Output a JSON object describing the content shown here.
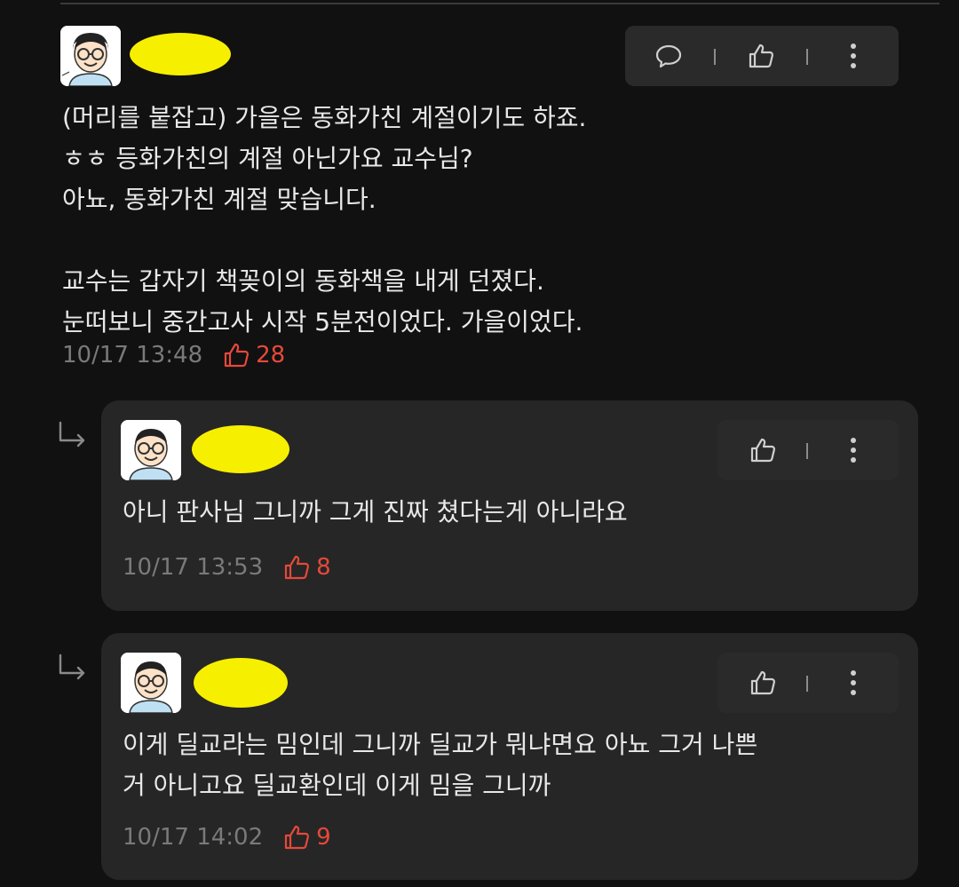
{
  "comment": {
    "body": "(머리를 붙잡고) 가을은 동화가친 계절이기도 하죠.\nㅎㅎ 등화가친의 계절 아닌가요 교수님?\n아뇨, 동화가친 계절 맞습니다.\n\n교수는 갑자기 책꽂이의 동화책을 내게 던졌다.\n눈떠보니 중간고사 시작 5분전이었다. 가을이었다.",
    "time": "10/17 13:48",
    "likes": "28",
    "actions": [
      "comment-icon",
      "thumbs-up-icon",
      "more-vert-icon"
    ]
  },
  "replies": [
    {
      "body": "아니 판사님 그니까 그게 진짜 쳤다는게 아니라요",
      "time": "10/17 13:53",
      "likes": "8",
      "actions": [
        "thumbs-up-icon",
        "more-vert-icon"
      ]
    },
    {
      "body": "이게 딜교라는 밈인데 그니까 딜교가 뭐냐면요 아뇨 그거 나쁜\n거 아니고요 딜교환인데 이게 밈을 그니까",
      "time": "10/17 14:02",
      "likes": "9",
      "actions": [
        "thumbs-up-icon",
        "more-vert-icon"
      ]
    }
  ],
  "colors": {
    "background": "#111111",
    "card": "#262626",
    "like_accent": "#e5493a",
    "redaction": "#f7ef00"
  }
}
